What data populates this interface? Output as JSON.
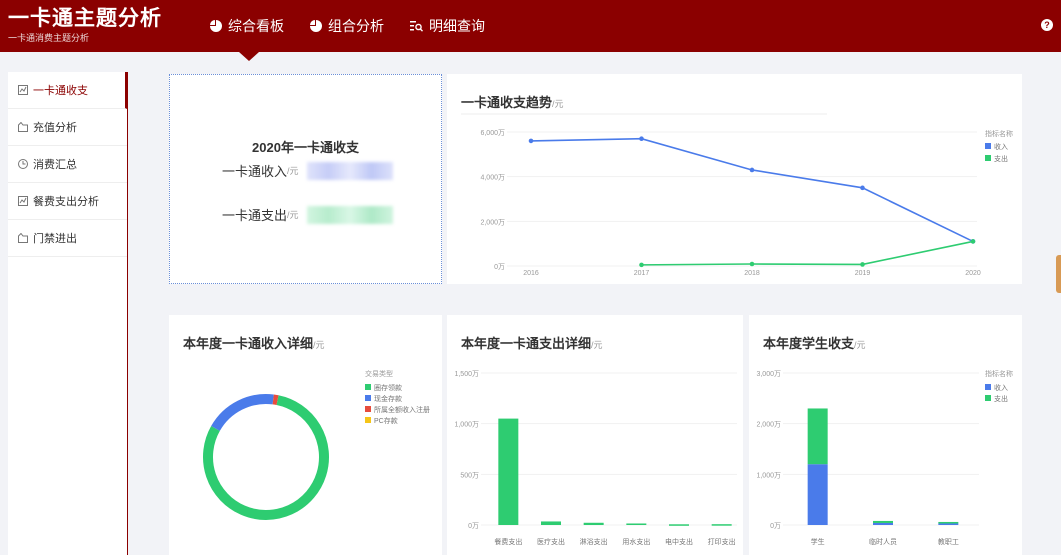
{
  "header": {
    "title": "一卡通主题分析",
    "subtitle": "一卡通消费主题分析",
    "help": "?",
    "nav": [
      {
        "label": "综合看板",
        "icon": "pie-chart-icon"
      },
      {
        "label": "组合分析",
        "icon": "pie-chart-icon"
      },
      {
        "label": "明细查询",
        "icon": "search-list-icon"
      }
    ]
  },
  "sidebar": {
    "items": [
      {
        "label": "一卡通收支",
        "icon": "chart-icon",
        "active": true
      },
      {
        "label": "充值分析",
        "icon": "wallet-icon",
        "active": false
      },
      {
        "label": "消费汇总",
        "icon": "clock-icon",
        "active": false
      },
      {
        "label": "餐费支出分析",
        "icon": "chart-icon",
        "active": false
      },
      {
        "label": "门禁进出",
        "icon": "wallet-icon",
        "active": false
      }
    ]
  },
  "summary": {
    "title": "2020年一卡通收支",
    "income_label": "一卡通收入",
    "expense_label": "一卡通支出",
    "unit": "/元"
  },
  "colors": {
    "blue": "#4a7bea",
    "green": "#2ecc71",
    "red": "#e74c3c",
    "yellow": "#f5c518",
    "header": "#8b0000"
  },
  "chart_data": [
    {
      "id": "trend",
      "type": "line",
      "title": "一卡通收支趋势",
      "unit": "/元",
      "legend_title": "指标名称",
      "x": [
        "2016",
        "2017",
        "2018",
        "2019",
        "2020"
      ],
      "y_ticks": [
        "0万",
        "2,000万",
        "4,000万",
        "6,000万"
      ],
      "ylim": [
        0,
        6000
      ],
      "series": [
        {
          "name": "收入",
          "values": [
            5600,
            5700,
            4300,
            3500,
            1100
          ]
        },
        {
          "name": "支出",
          "values": [
            null,
            50,
            90,
            70,
            1100
          ]
        }
      ]
    },
    {
      "id": "income",
      "type": "pie",
      "title": "本年度一卡通收入详细",
      "unit": "/元",
      "legend_title": "交易类型",
      "slices": [
        {
          "name": "圈存领款",
          "value": 80
        },
        {
          "name": "现金存款",
          "value": 18.8
        },
        {
          "name": "所属全额收入注册",
          "value": 1.2
        },
        {
          "name": "PC存款",
          "value": 0
        }
      ]
    },
    {
      "id": "expense",
      "type": "bar",
      "title": "本年度一卡通支出详细",
      "unit": "/元",
      "categories": [
        "餐费支出",
        "医疗支出",
        "淋浴支出",
        "用水支出",
        "电中支出",
        "打印支出"
      ],
      "values": [
        1050,
        35,
        22,
        15,
        7,
        8
      ],
      "y_ticks": [
        "0万",
        "500万",
        "1,000万",
        "1,500万"
      ],
      "ylim": [
        0,
        1500
      ]
    },
    {
      "id": "student",
      "type": "bar",
      "title": "本年度学生收支",
      "unit": "/元",
      "legend_title": "指标名称",
      "categories": [
        "学生",
        "临时人员",
        "教职工"
      ],
      "y_ticks": [
        "0万",
        "1,000万",
        "2,000万",
        "3,000万"
      ],
      "ylim": [
        0,
        3000
      ],
      "series": [
        {
          "name": "收入",
          "values": [
            1200,
            40,
            30
          ]
        },
        {
          "name": "支出",
          "values": [
            1100,
            40,
            30
          ]
        }
      ]
    }
  ]
}
